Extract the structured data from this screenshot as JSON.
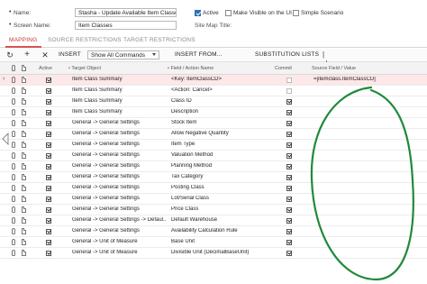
{
  "header": {
    "name_label": "Name:",
    "name_value": "Stasha - Update Available Item Classes",
    "screen_label": "Screen Name:",
    "screen_value": "Item Classes",
    "active_label": "Active",
    "visible_label": "Make Visible on the UI",
    "simple_label": "Simple Scenario",
    "sitemap_label": "Site Map Title:",
    "active_checked": true,
    "visible_checked": false,
    "simple_checked": false
  },
  "tabs": [
    {
      "label": "MAPPING",
      "active": true
    },
    {
      "label": "SOURCE RESTRICTIONS",
      "active": false
    },
    {
      "label": "TARGET RESTRICTIONS",
      "active": false
    }
  ],
  "toolbar": {
    "refresh_icon": "refresh-icon",
    "add_icon": "plus-icon",
    "delete_icon": "close-icon",
    "insert_label": "INSERT",
    "commands_value": "Show All Commands",
    "insert_from_label": "INSERT FROM...",
    "substitution_label": "SUBSTITUTION LISTS",
    "fit_icon": "fit-columns-icon"
  },
  "grid": {
    "columns": {
      "active": "Active",
      "target": "Target Object",
      "field": "Field / Action Name",
      "commit": "Commit",
      "source": "Source Field / Value"
    },
    "rows": [
      {
        "target": "Item Class Summary",
        "field": "<Key: ItemClassCD>",
        "active": true,
        "commit": false,
        "commit_disabled": true,
        "source": "=[itemclass.ItemClassCD]",
        "selected": true
      },
      {
        "target": "Item Class Summary",
        "field": "<Action: Cancel>",
        "active": true,
        "commit": false,
        "commit_disabled": true,
        "source": "",
        "selected": false
      },
      {
        "target": "Item Class Summary",
        "field": "Class ID",
        "active": true,
        "commit": true,
        "commit_disabled": false,
        "source": "",
        "selected": false
      },
      {
        "target": "Item Class Summary",
        "field": "Description",
        "active": true,
        "commit": true,
        "commit_disabled": false,
        "source": "",
        "selected": false
      },
      {
        "target": "General -> General Settings",
        "field": "Stock Item",
        "active": true,
        "commit": true,
        "commit_disabled": false,
        "source": "",
        "selected": false
      },
      {
        "target": "General -> General Settings",
        "field": "Allow Negative Quantity",
        "active": true,
        "commit": true,
        "commit_disabled": false,
        "source": "",
        "selected": false
      },
      {
        "target": "General -> General Settings",
        "field": "Item Type",
        "active": true,
        "commit": true,
        "commit_disabled": false,
        "source": "",
        "selected": false
      },
      {
        "target": "General -> General Settings",
        "field": "Valuation Method",
        "active": true,
        "commit": true,
        "commit_disabled": false,
        "source": "",
        "selected": false
      },
      {
        "target": "General -> General Settings",
        "field": "Planning Method",
        "active": true,
        "commit": true,
        "commit_disabled": false,
        "source": "",
        "selected": false
      },
      {
        "target": "General -> General Settings",
        "field": "Tax Category",
        "active": true,
        "commit": true,
        "commit_disabled": false,
        "source": "",
        "selected": false
      },
      {
        "target": "General -> General Settings",
        "field": "Posting Class",
        "active": true,
        "commit": true,
        "commit_disabled": false,
        "source": "",
        "selected": false
      },
      {
        "target": "General -> General Settings",
        "field": "Lot/Serial Class",
        "active": true,
        "commit": true,
        "commit_disabled": false,
        "source": "",
        "selected": false
      },
      {
        "target": "General -> General Settings",
        "field": "Price Class",
        "active": true,
        "commit": true,
        "commit_disabled": false,
        "source": "",
        "selected": false
      },
      {
        "target": "General -> General Settings -> Defaul...",
        "field": "Default Warehouse",
        "active": true,
        "commit": true,
        "commit_disabled": false,
        "source": "",
        "selected": false
      },
      {
        "target": "General -> General Settings",
        "field": "Availability Calculation Rule",
        "active": true,
        "commit": true,
        "commit_disabled": false,
        "source": "",
        "selected": false
      },
      {
        "target": "General -> Unit of Measure",
        "field": "Base Unit",
        "active": true,
        "commit": true,
        "commit_disabled": false,
        "source": "",
        "selected": false
      },
      {
        "target": "General -> Unit of Measure",
        "field": "Divisible Unit (DecimalBaseUnit)",
        "active": true,
        "commit": true,
        "commit_disabled": false,
        "source": "",
        "selected": false
      }
    ]
  },
  "annotation_color": "#1f8a3a",
  "accent_color": "#c0392b",
  "selected_row_color": "#fde7e7"
}
